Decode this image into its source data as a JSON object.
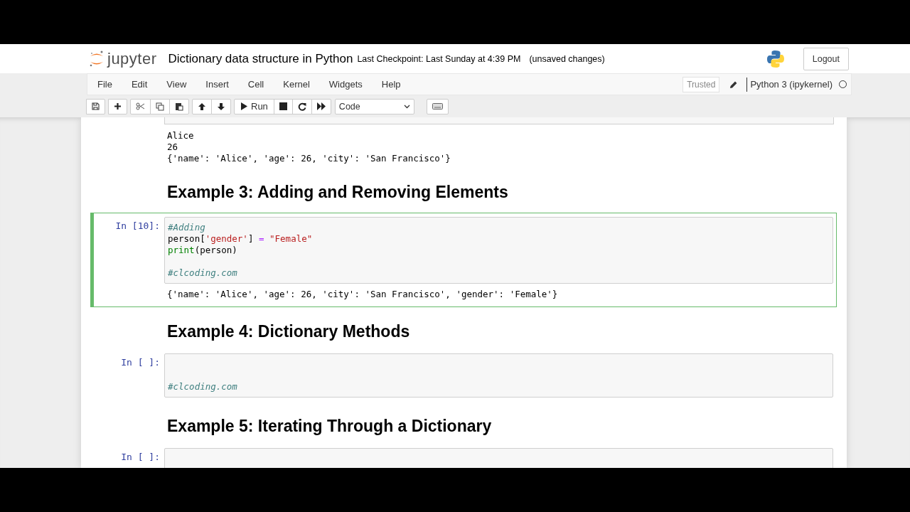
{
  "header": {
    "logo_text": "jupyter",
    "notebook_title": "Dictionary data structure in Python",
    "checkpoint": "Last Checkpoint: Last Sunday at 4:39 PM",
    "save_status": "(unsaved changes)",
    "logout": "Logout"
  },
  "menu": [
    {
      "label": "File"
    },
    {
      "label": "Edit"
    },
    {
      "label": "View"
    },
    {
      "label": "Insert"
    },
    {
      "label": "Cell"
    },
    {
      "label": "Kernel"
    },
    {
      "label": "Widgets"
    },
    {
      "label": "Help"
    }
  ],
  "trusted": "Trusted",
  "kernel": {
    "name": "Python 3 (ipykernel)",
    "busy": false
  },
  "toolbar": {
    "run_label": "Run",
    "cell_type": "Code"
  },
  "cells": [
    {
      "kind": "output",
      "lines": [
        "Alice",
        "26",
        "{'name': 'Alice', 'age': 26, 'city': 'San Francisco'}"
      ]
    },
    {
      "kind": "markdown",
      "text": "Example 3: Adding and Removing Elements"
    },
    {
      "kind": "code",
      "selected": true,
      "prompt": "In [10]:",
      "lines": [
        {
          "kind": "code",
          "tokens": [
            {
              "kind": "comment",
              "text": "#Adding"
            }
          ]
        },
        {
          "kind": "code",
          "tokens": [
            {
              "kind": "plain",
              "text": "person["
            },
            {
              "kind": "string",
              "text": "'gender'"
            },
            {
              "kind": "plain",
              "text": "] "
            },
            {
              "kind": "op",
              "text": "="
            },
            {
              "kind": "string",
              "text": " \"Female\""
            }
          ]
        },
        {
          "kind": "code",
          "tokens": [
            {
              "kind": "builtin",
              "text": "print"
            },
            {
              "kind": "plain",
              "text": "(person)"
            }
          ]
        },
        {
          "kind": "blank"
        },
        {
          "kind": "code",
          "tokens": [
            {
              "kind": "comment",
              "text": "#clcoding.com"
            }
          ]
        }
      ],
      "output": [
        "{'name': 'Alice', 'age': 26, 'city': 'San Francisco', 'gender': 'Female'}"
      ]
    },
    {
      "kind": "markdown",
      "text": "Example 4: Dictionary Methods"
    },
    {
      "kind": "code",
      "selected": false,
      "prompt": "In [ ]:",
      "lines": [
        {
          "kind": "blank"
        },
        {
          "kind": "blank"
        },
        {
          "kind": "code",
          "tokens": [
            {
              "kind": "comment",
              "text": "#clcoding.com"
            }
          ]
        }
      ]
    },
    {
      "kind": "markdown",
      "text": "Example 5: Iterating Through a Dictionary"
    },
    {
      "kind": "code",
      "selected": false,
      "prompt": "In [ ]:",
      "lines": [
        {
          "kind": "blank"
        }
      ]
    }
  ]
}
